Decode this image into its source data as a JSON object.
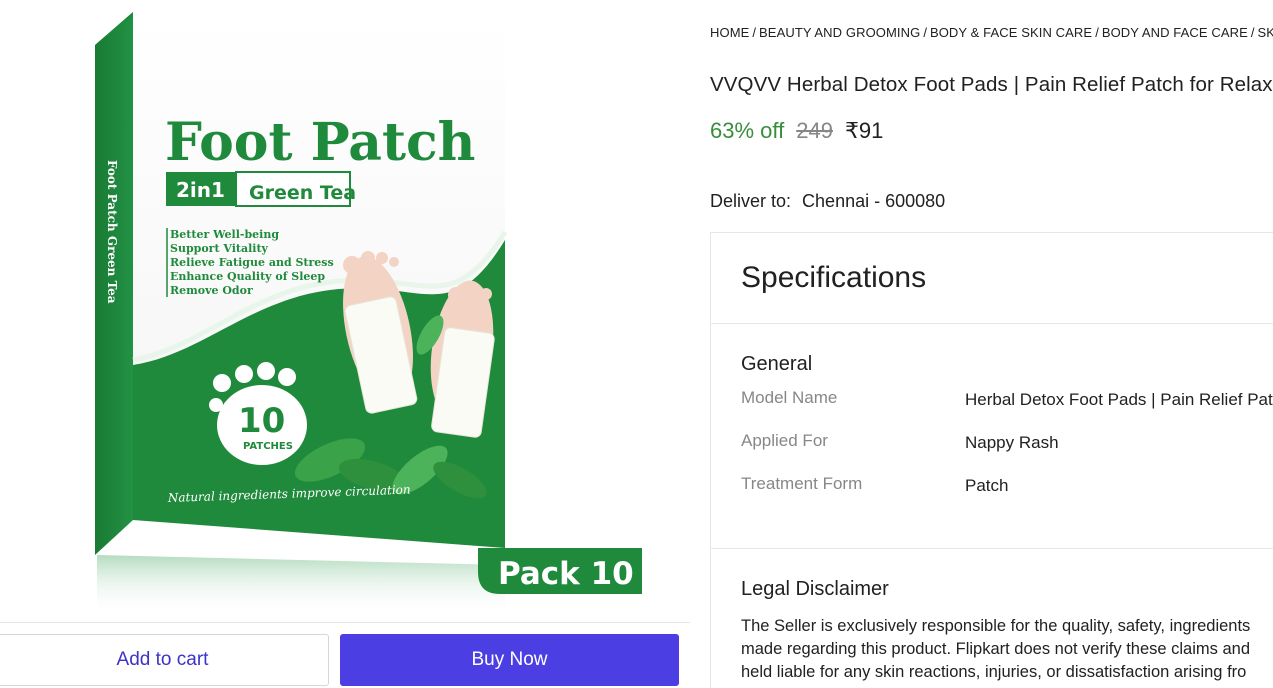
{
  "image": {
    "brand_title": "Foot Patch",
    "badge_left": "2in1",
    "badge_right": "Green Tea",
    "bullets": [
      "Better Well-being",
      "Support Vitality",
      "Relieve Fatigue and Stress",
      "Enhance Quality of Sleep",
      "Remove Odor"
    ],
    "count": "10",
    "count_label": "PATCHES",
    "tagline": "Natural ingredients improve circulation",
    "side_text": "Foot Patch  Green Tea",
    "pack_label": "Pack 10",
    "colors": {
      "green": "#1f8a3b",
      "white": "#ffffff"
    }
  },
  "actions": {
    "add_to_cart": "Add to cart",
    "buy_now": "Buy Now"
  },
  "breadcrumb": [
    "HOME",
    "BEAUTY AND GROOMING",
    "BODY & FACE SKIN CARE",
    "BODY AND FACE CARE",
    "SKIN T"
  ],
  "product": {
    "title": "VVQVV Herbal Detox Foot Pads | Pain Relief Patch for Relax",
    "discount": "63% off",
    "mrp": "249",
    "price": "₹91"
  },
  "delivery": {
    "label": "Deliver to:",
    "location": "Chennai - 600080"
  },
  "specifications": {
    "title": "Specifications",
    "general_title": "General",
    "rows": [
      {
        "key": "Model Name",
        "value": "Herbal Detox Foot Pads | Pain Relief Patc"
      },
      {
        "key": "Applied For",
        "value": "Nappy Rash"
      },
      {
        "key": "Treatment Form",
        "value": "Patch"
      }
    ],
    "legal_title": "Legal Disclaimer",
    "legal_text": "The Seller is exclusively responsible for the quality, safety, ingredients made regarding this product. Flipkart does not verify these claims and held liable for any skin reactions, injuries, or dissatisfaction arising fro"
  }
}
